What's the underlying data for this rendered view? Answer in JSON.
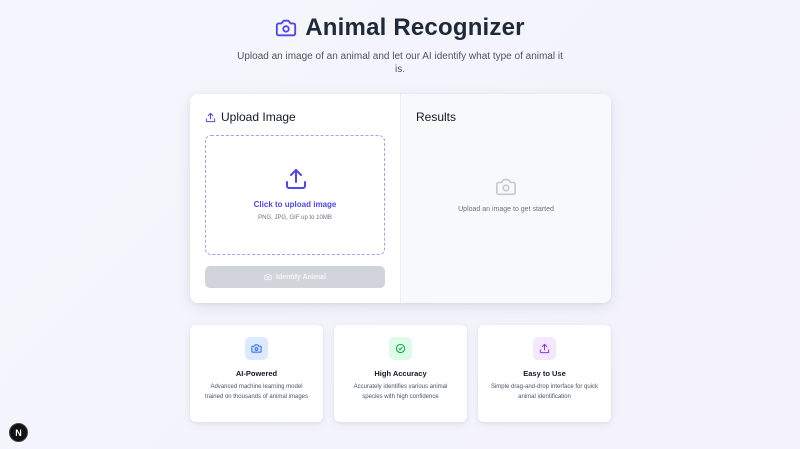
{
  "header": {
    "title": "Animal Recognizer",
    "subtitle": "Upload an image of an animal and let our AI identify what type of animal it is.",
    "icon": "camera-icon"
  },
  "upload_panel": {
    "heading": "Upload Image",
    "heading_icon": "upload-icon",
    "dropzone": {
      "title": "Click to upload image",
      "hint": "PNG, JPG, GIF up to 10MB",
      "icon": "upload-icon"
    },
    "button": {
      "label": "Identify Animal",
      "icon": "camera-icon",
      "disabled": true
    }
  },
  "results_panel": {
    "heading": "Results",
    "placeholder": "Upload an image to get started",
    "icon": "camera-icon"
  },
  "features": [
    {
      "title": "AI-Powered",
      "description": "Advanced machine learning model trained on thousands of animal images",
      "icon": "camera-icon",
      "color": "#2563eb",
      "bg": "#dbeafe"
    },
    {
      "title": "High Accuracy",
      "description": "Accurately identifies various animal species with high confidence",
      "icon": "check-circle-icon",
      "color": "#16a34a",
      "bg": "#dcfce7"
    },
    {
      "title": "Easy to Use",
      "description": "Simple drag-and-drop interface for quick animal identification",
      "icon": "upload-icon",
      "color": "#9333ea",
      "bg": "#f3e8ff"
    }
  ],
  "colors": {
    "accent": "#4f46e5",
    "button_disabled": "#d1d5db"
  },
  "badge": {
    "label": "N"
  }
}
